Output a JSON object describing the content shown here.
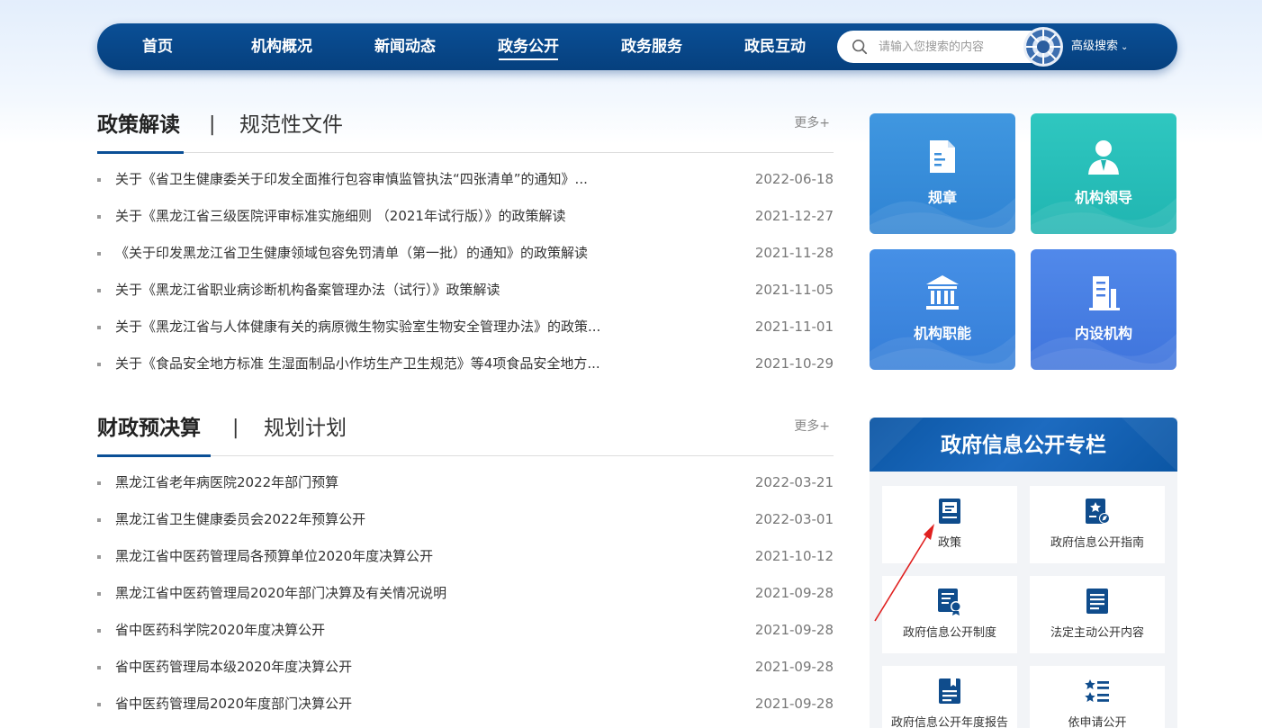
{
  "nav": {
    "items": [
      {
        "label": "首页",
        "active": false
      },
      {
        "label": "机构概况",
        "active": false
      },
      {
        "label": "新闻动态",
        "active": false
      },
      {
        "label": "政务公开",
        "active": true
      },
      {
        "label": "政务服务",
        "active": false
      },
      {
        "label": "政民互动",
        "active": false
      }
    ],
    "search_placeholder": "请输入您搜索的内容",
    "advanced_search": "高级搜索"
  },
  "policy_section": {
    "tab_main": "政策解读",
    "separator": "|",
    "tab_sub": "规范性文件",
    "more": "更多+",
    "items": [
      {
        "title": "关于《省卫生健康委关于印发全面推行包容审慎监管执法“四张清单”的通知》...",
        "date": "2022-06-18"
      },
      {
        "title": "关于《黑龙江省三级医院评审标准实施细则 （2021年试行版）》的政策解读",
        "date": "2021-12-27"
      },
      {
        "title": "《关于印发黑龙江省卫生健康领域包容免罚清单（第一批）的通知》的政策解读",
        "date": "2021-11-28"
      },
      {
        "title": "关于《黑龙江省职业病诊断机构备案管理办法（试行）》政策解读",
        "date": "2021-11-05"
      },
      {
        "title": "关于《黑龙江省与人体健康有关的病原微生物实验室生物安全管理办法》的政策...",
        "date": "2021-11-01"
      },
      {
        "title": "关于《食品安全地方标准 生湿面制品小作坊生产卫生规范》等4项食品安全地方...",
        "date": "2021-10-29"
      }
    ]
  },
  "finance_section": {
    "tab_main": "财政预决算",
    "separator": "|",
    "tab_sub": "规划计划",
    "more": "更多+",
    "items": [
      {
        "title": "黑龙江省老年病医院2022年部门预算",
        "date": "2022-03-21"
      },
      {
        "title": "黑龙江省卫生健康委员会2022年预算公开",
        "date": "2022-03-01"
      },
      {
        "title": "黑龙江省中医药管理局各预算单位2020年度决算公开",
        "date": "2021-10-12"
      },
      {
        "title": "黑龙江省中医药管理局2020年部门决算及有关情况说明",
        "date": "2021-09-28"
      },
      {
        "title": "省中医药科学院2020年度决算公开",
        "date": "2021-09-28"
      },
      {
        "title": "省中医药管理局本级2020年度决算公开",
        "date": "2021-09-28"
      },
      {
        "title": "省中医药管理局2020年度部门决算公开",
        "date": "2021-09-28"
      }
    ]
  },
  "tiles": [
    {
      "label": "规章",
      "icon": "document-icon",
      "color": "#3b8fdc"
    },
    {
      "label": "机构领导",
      "icon": "person-icon",
      "color": "#27bfb9"
    },
    {
      "label": "机构职能",
      "icon": "institution-icon",
      "color": "#3e86e0"
    },
    {
      "label": "内设机构",
      "icon": "building-icon",
      "color": "#4a7fe3"
    }
  ],
  "info_panel": {
    "title": "政府信息公开专栏",
    "cards": [
      {
        "label": "政策",
        "icon": "book-icon"
      },
      {
        "label": "政府信息公开指南",
        "icon": "guide-icon"
      },
      {
        "label": "政府信息公开制度",
        "icon": "certificate-icon"
      },
      {
        "label": "法定主动公开内容",
        "icon": "list-document-icon"
      },
      {
        "label": "政府信息公开年度报告",
        "icon": "report-icon"
      },
      {
        "label": "依申请公开",
        "icon": "star-list-icon"
      }
    ]
  },
  "colors": {
    "nav_bg": "#0a4f96",
    "accent": "#0a4f96",
    "arrow": "#e0201f",
    "card_icon": "#0f4c8c"
  }
}
